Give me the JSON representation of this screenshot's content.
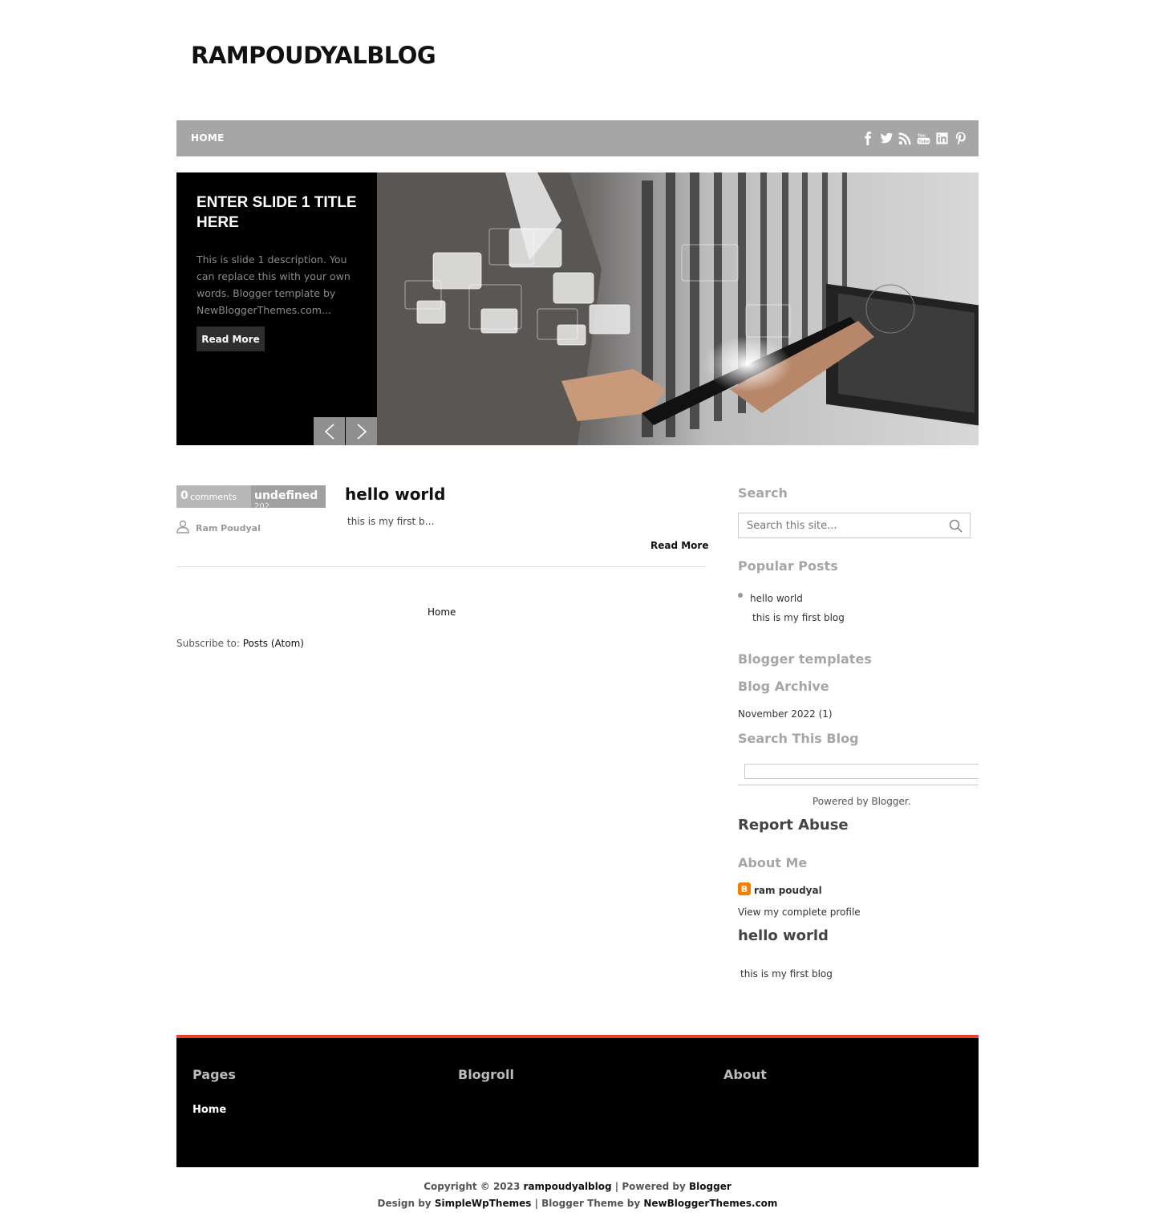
{
  "header": {
    "title": "RAMPOUDYALBLOG"
  },
  "nav": {
    "home": "HOME",
    "social_icons": [
      "facebook-icon",
      "twitter-icon",
      "rss-icon",
      "youtube-icon",
      "linkedin-icon",
      "pinterest-icon"
    ]
  },
  "slider": {
    "title": "ENTER SLIDE 1 TITLE HERE",
    "description": "This is slide 1 description. You can replace this with your own words. Blogger template by NewBloggerThemes.com...",
    "button": "Read More"
  },
  "post": {
    "comment_count": "0",
    "comment_label": "comments",
    "date_top": "undefined",
    "date_bottom": "202",
    "author": "Ram Poudyal",
    "title": "hello world",
    "snippet": "this is my first b…",
    "read_more": "Read More"
  },
  "pager": {
    "home": "Home"
  },
  "subscribe": {
    "prefix": "Subscribe to: ",
    "link": "Posts (Atom)"
  },
  "sidebar": {
    "search_heading": "Search",
    "search_placeholder": "Search this site...",
    "popular_heading": "Popular Posts",
    "popular_title": "hello world",
    "popular_snippet": "this is my first blog",
    "templates_heading": "Blogger templates",
    "archive_heading": "Blog Archive",
    "archive_item": "November 2022 (1)",
    "search_blog_heading": "Search This Blog",
    "powered_by": "Powered by Blogger.",
    "report_abuse": "Report Abuse",
    "about_heading": "About Me",
    "about_name": "ram poudyal",
    "about_profile": "View my complete profile",
    "featured_title": "hello world",
    "featured_snippet": "this is my first blog"
  },
  "footer": {
    "pages_heading": "Pages",
    "pages_link": "Home",
    "blogroll_heading": "Blogroll",
    "about_heading": "About"
  },
  "credits": {
    "line1_prefix": "Copyright © 2023 ",
    "site": "rampoudyalblog",
    "line1_mid": " | Powered by ",
    "blogger": "Blogger",
    "line2_prefix": "Design by ",
    "designer": "SimpleWpThemes",
    "line2_mid": " | Blogger Theme by ",
    "theme_site": "NewBloggerThemes.com"
  },
  "colors": {
    "nav_bg": "#a6a6a6",
    "footer_accent": "#e8412b",
    "footer_bg": "#000000"
  }
}
